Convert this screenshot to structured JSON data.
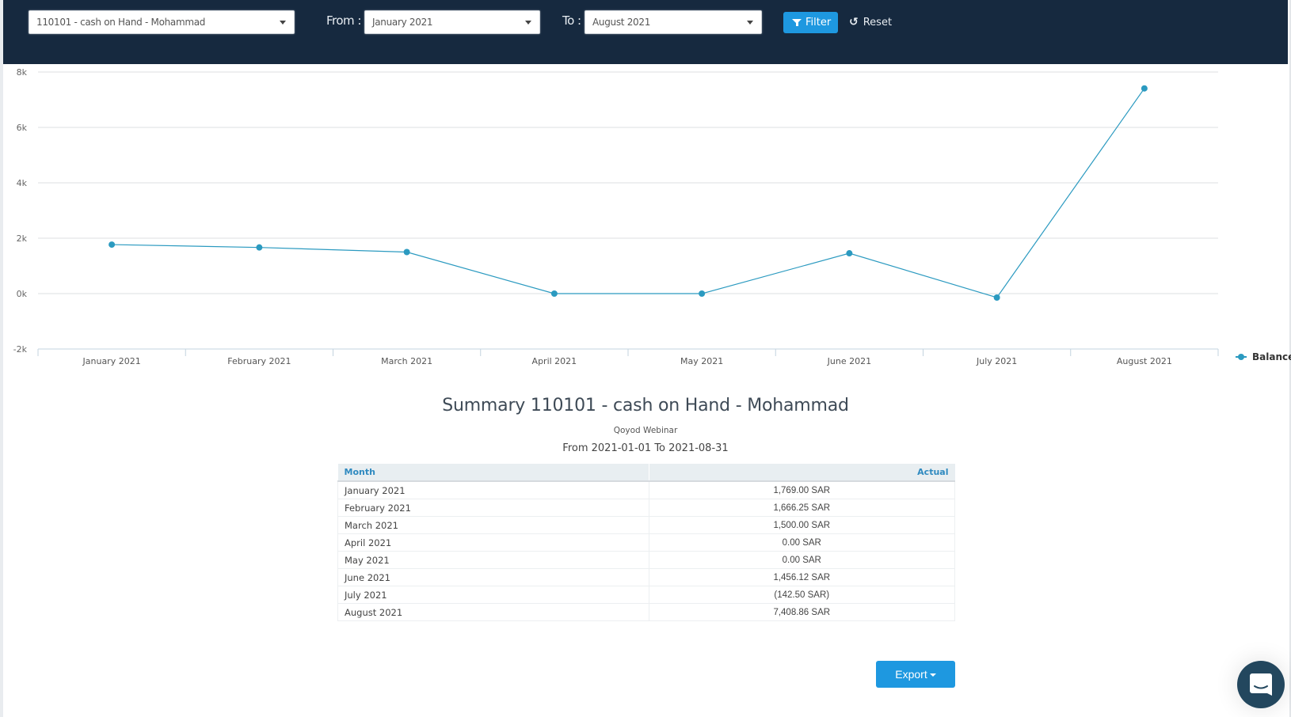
{
  "header": {
    "account_select": {
      "value": "110101 - cash on Hand - Mohammad"
    },
    "from_label": "From :",
    "from_select": {
      "value": "January 2021"
    },
    "to_label": "To :",
    "to_select": {
      "value": "August 2021"
    },
    "filter_label": "Filter",
    "reset_label": "Reset",
    "colors": {
      "background": "#16293f",
      "filter_button": "#1e98e0"
    }
  },
  "chart_data": {
    "type": "line",
    "title": "",
    "xlabel": "",
    "ylabel": "",
    "categories": [
      "January 2021",
      "February 2021",
      "March 2021",
      "April 2021",
      "May 2021",
      "June 2021",
      "July 2021",
      "August 2021"
    ],
    "series": [
      {
        "name": "Balance",
        "color": "#2b9ac0",
        "values": [
          1769.0,
          1666.25,
          1500.0,
          0.0,
          0.0,
          1456.12,
          -142.5,
          7408.86
        ]
      }
    ],
    "yticks": [
      -2000,
      0,
      2000,
      4000,
      6000,
      8000
    ],
    "ytick_labels": [
      "-2k",
      "0k",
      "2k",
      "4k",
      "6k",
      "8k"
    ],
    "ylim": [
      -2000,
      8000
    ],
    "grid": true,
    "legend": {
      "position": "right",
      "entries": [
        "Balance"
      ]
    }
  },
  "summary": {
    "title": "Summary 110101 - cash on Hand - Mohammad",
    "company": "Qoyod Webinar",
    "range": "From 2021-01-01 To 2021-08-31",
    "columns": [
      "Month",
      "Actual"
    ],
    "rows": [
      {
        "month": "January 2021",
        "actual": "1,769.00 SAR"
      },
      {
        "month": "February 2021",
        "actual": "1,666.25 SAR"
      },
      {
        "month": "March 2021",
        "actual": "1,500.00 SAR"
      },
      {
        "month": "April 2021",
        "actual": "0.00 SAR"
      },
      {
        "month": "May 2021",
        "actual": "0.00 SAR"
      },
      {
        "month": "June 2021",
        "actual": "1,456.12 SAR"
      },
      {
        "month": "July 2021",
        "actual": "(142.50 SAR)"
      },
      {
        "month": "August 2021",
        "actual": "7,408.86 SAR"
      }
    ]
  },
  "export_label": "Export",
  "icons": {
    "filter": "filter-funnel-icon",
    "reset": "undo-icon",
    "chat": "chat-bubble-icon",
    "dropdown": "caret-down-icon"
  }
}
